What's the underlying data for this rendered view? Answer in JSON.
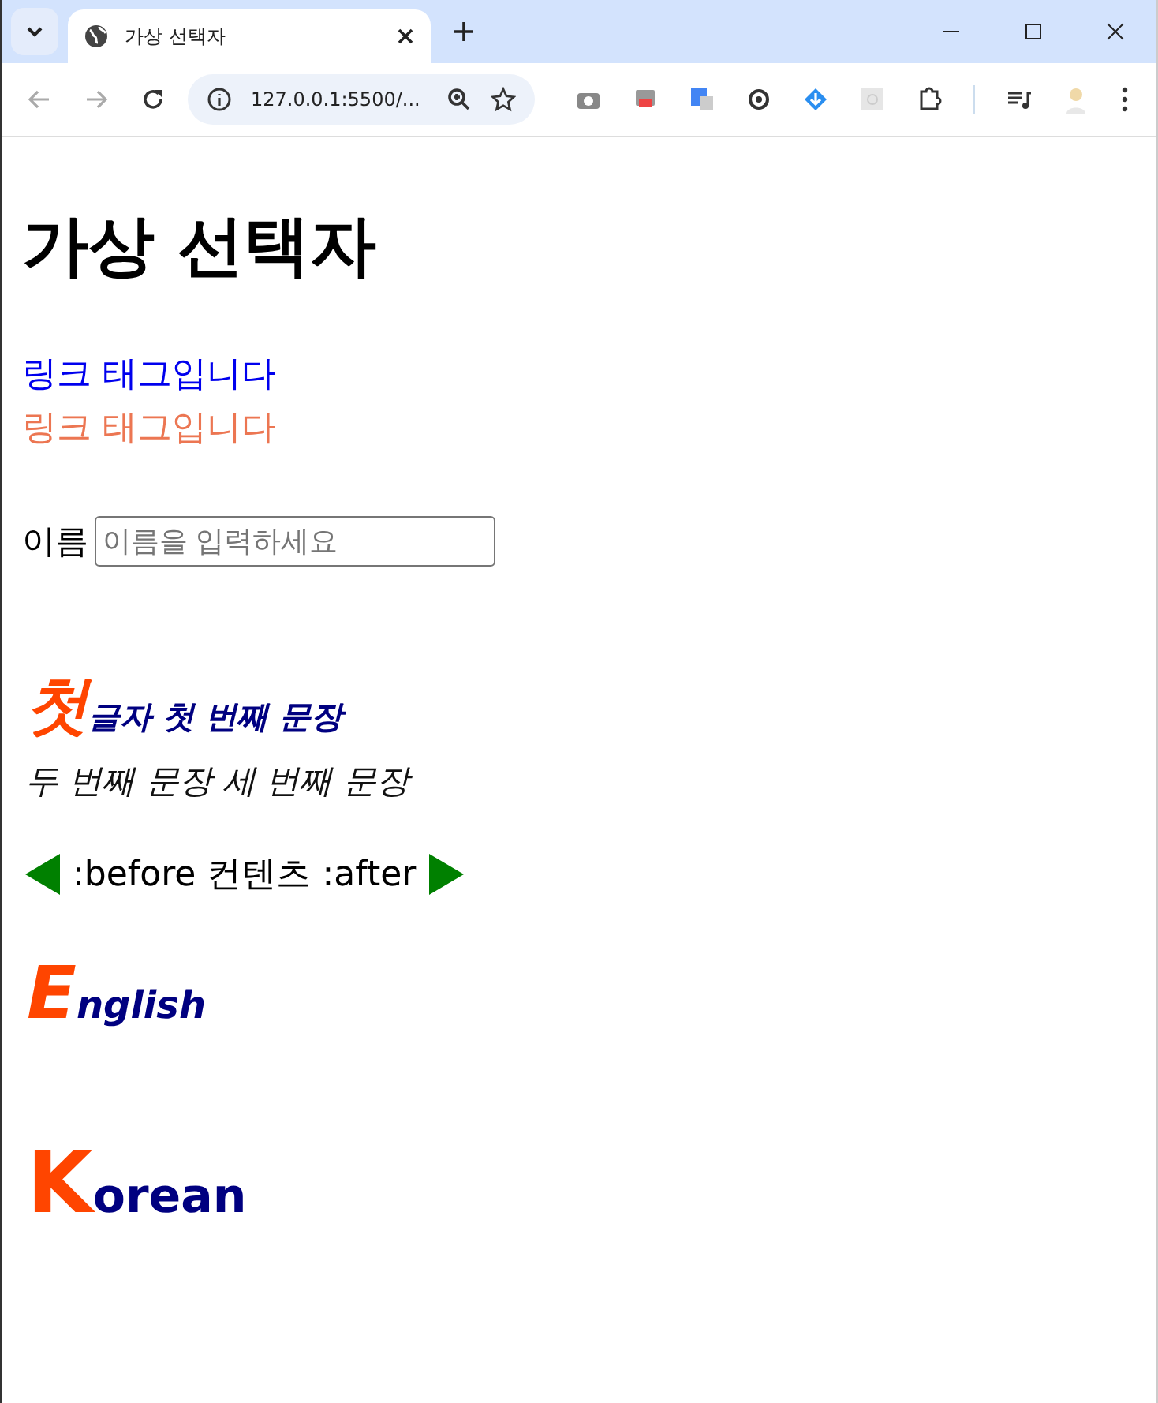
{
  "browser": {
    "tab_title": "가상 선택자",
    "address": "127.0.0.1:5500/..."
  },
  "page": {
    "title": "가상 선택자",
    "links": [
      {
        "text": "링크 태그입니다",
        "visited": false
      },
      {
        "text": "링크 태그입니다",
        "visited": true
      }
    ],
    "name_field": {
      "label": "이름",
      "placeholder": "이름을 입력하세요"
    },
    "first_letter_paragraph": {
      "first_line": "첫글자 첫 번째 문장",
      "second_line": "두 번째 문장 세 번째 문장"
    },
    "before_after_text": ":before 컨텐츠 :after",
    "first_letter_words": [
      {
        "text": "English",
        "kind": "italic"
      },
      {
        "text": "Korean",
        "kind": "upright"
      }
    ]
  }
}
